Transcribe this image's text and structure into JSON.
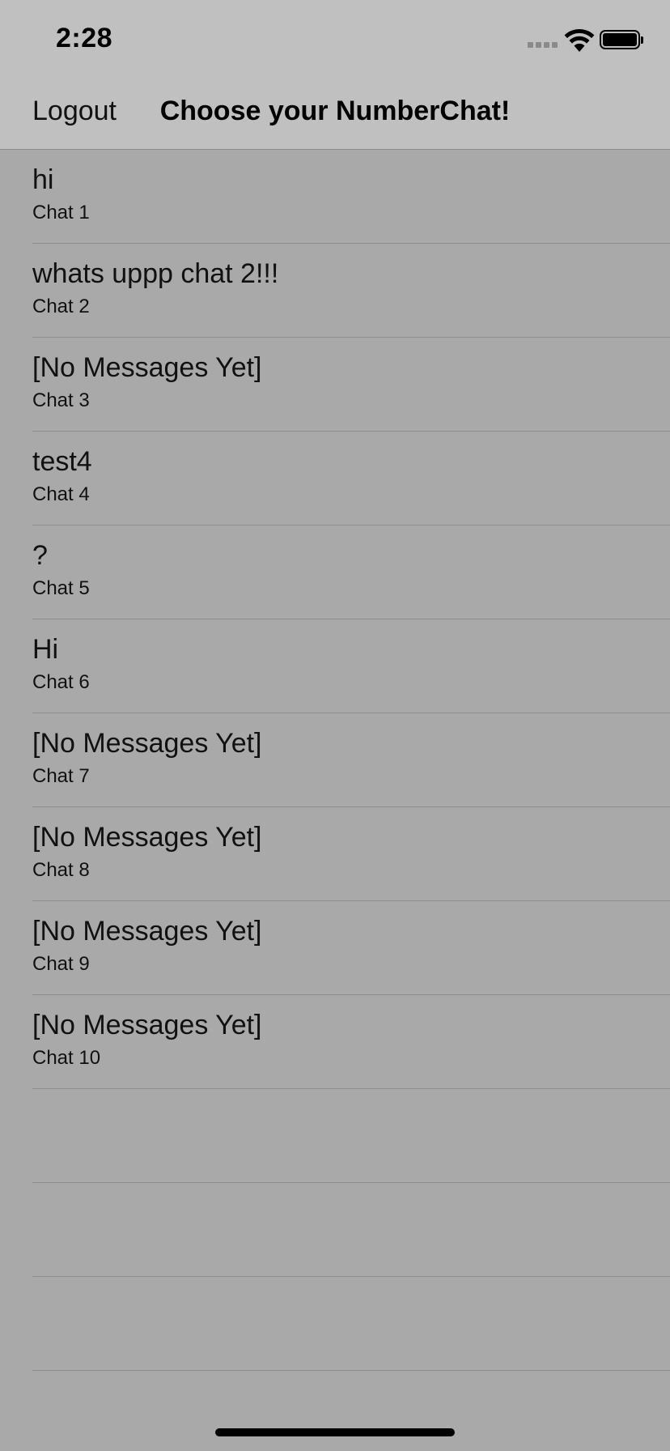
{
  "status_bar": {
    "time": "2:28",
    "icons": [
      "signal-icon",
      "wifi-icon",
      "battery-icon"
    ]
  },
  "nav": {
    "logout_label": "Logout",
    "title": "Choose your NumberChat!"
  },
  "chats": [
    {
      "message": "hi",
      "name": "Chat 1"
    },
    {
      "message": "whats uppp chat 2!!!",
      "name": "Chat 2"
    },
    {
      "message": "[No Messages Yet]",
      "name": "Chat 3"
    },
    {
      "message": "test4",
      "name": "Chat 4"
    },
    {
      "message": "?",
      "name": "Chat 5"
    },
    {
      "message": "Hi",
      "name": "Chat 6"
    },
    {
      "message": "[No Messages Yet]",
      "name": "Chat 7"
    },
    {
      "message": "[No Messages Yet]",
      "name": "Chat 8"
    },
    {
      "message": "[No Messages Yet]",
      "name": "Chat 9"
    },
    {
      "message": "[No Messages Yet]",
      "name": "Chat 10"
    }
  ],
  "colors": {
    "background": "#a9a9a9",
    "bars": "#c0c0c0",
    "text": "#111111"
  }
}
